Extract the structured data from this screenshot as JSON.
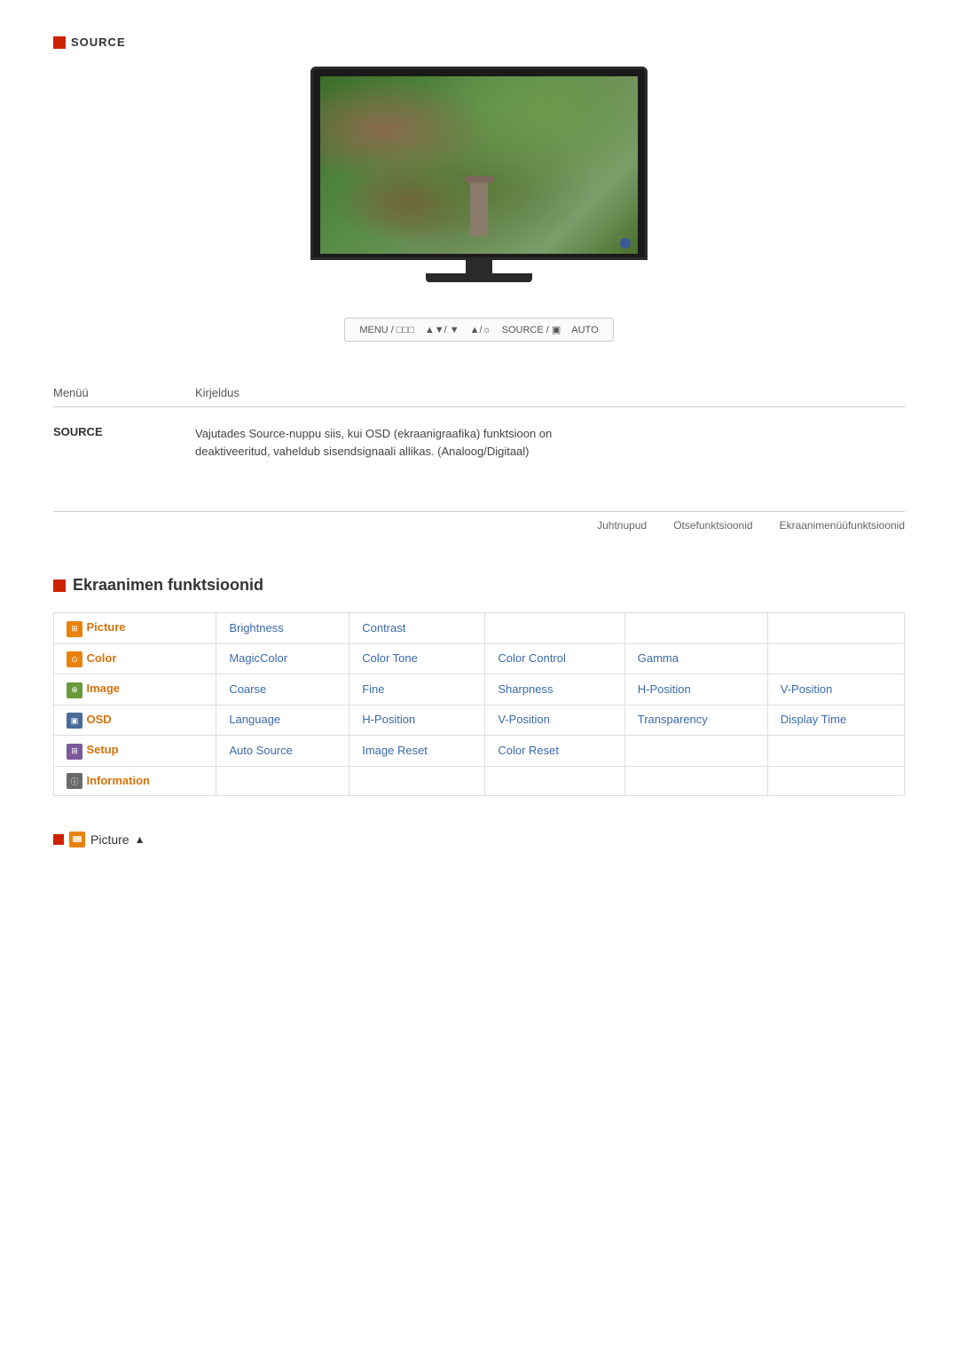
{
  "source_section": {
    "icon_label": "■",
    "label": "SOURCE"
  },
  "control_bar": {
    "items": [
      "MENU / □□□",
      "▲▼/ ▼",
      "▲/☼",
      "SOURCE / ▣",
      "AUTO"
    ]
  },
  "description_table": {
    "col1_header": "Menüü",
    "col2_header": "Kirjeldus",
    "rows": [
      {
        "menu": "SOURCE",
        "desc": "Vajutades Source-nuppu siis, kui OSD (ekraanigraafika) funktsioon on\ndeaktiveeritud, vaheldub sisendsignaali allikas. (Analoog/Digitaal)"
      }
    ]
  },
  "nav_links": {
    "link1": "Juhtnupud",
    "link2": "Otsefunktsioonid",
    "link3": "Ekraanimenüüfunktsioonid"
  },
  "ekraan_section": {
    "icon_label": "▶",
    "title": "Ekraanimen  funktsioonid"
  },
  "menu_grid": {
    "rows": [
      {
        "category": {
          "icon": "picture",
          "color": "orange",
          "label": "Picture",
          "href": "#"
        },
        "col2": {
          "label": "Brightness",
          "href": "#"
        },
        "col3": {
          "label": "Contrast",
          "href": "#"
        },
        "col4": "",
        "col5": "",
        "col6": ""
      },
      {
        "category": {
          "icon": "color",
          "color": "orange",
          "label": "Color",
          "href": "#"
        },
        "col2": {
          "label": "MagicColor",
          "href": "#"
        },
        "col3": {
          "label": "Color Tone",
          "href": "#"
        },
        "col4": {
          "label": "Color Control",
          "href": "#"
        },
        "col5": {
          "label": "Gamma",
          "href": "#"
        },
        "col6": ""
      },
      {
        "category": {
          "icon": "image",
          "color": "green",
          "label": "Image",
          "href": "#"
        },
        "col2": {
          "label": "Coarse",
          "href": "#"
        },
        "col3": {
          "label": "Fine",
          "href": "#"
        },
        "col4": {
          "label": "Sharpness",
          "href": "#"
        },
        "col5": {
          "label": "H-Position",
          "href": "#"
        },
        "col6": {
          "label": "V-Position",
          "href": "#"
        }
      },
      {
        "category": {
          "icon": "osd",
          "color": "blue-dark",
          "label": "OSD",
          "href": "#"
        },
        "col2": {
          "label": "Language",
          "href": "#"
        },
        "col3": {
          "label": "H-Position",
          "href": "#"
        },
        "col4": {
          "label": "V-Position",
          "href": "#"
        },
        "col5": {
          "label": "Transparency",
          "href": "#"
        },
        "col6": {
          "label": "Display Time",
          "href": "#"
        }
      },
      {
        "category": {
          "icon": "setup",
          "color": "purple",
          "label": "Setup",
          "href": "#"
        },
        "col2": {
          "label": "Auto Source",
          "href": "#"
        },
        "col3": {
          "label": "Image Reset",
          "href": "#"
        },
        "col4": {
          "label": "Color Reset",
          "href": "#"
        },
        "col5": "",
        "col6": ""
      },
      {
        "category": {
          "icon": "info",
          "color": "gray",
          "label": "Information",
          "href": "#"
        },
        "col2": "",
        "col3": "",
        "col4": "",
        "col5": "",
        "col6": ""
      }
    ]
  },
  "picture_breadcrumb": {
    "label": "Picture",
    "arrow": "▲"
  }
}
